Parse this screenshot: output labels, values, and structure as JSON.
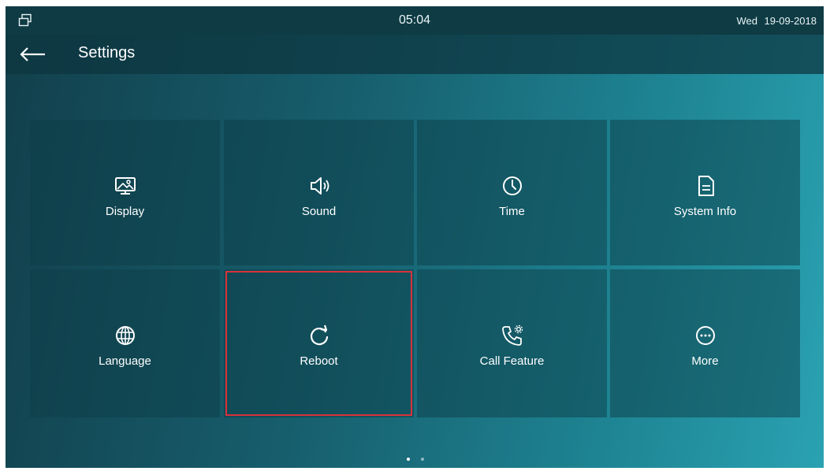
{
  "status_bar": {
    "time": "05:04",
    "day": "Wed",
    "date": "19-09-2018",
    "left_icon": "window-restore-icon"
  },
  "header": {
    "back_icon": "arrow-left-icon",
    "title": "Settings"
  },
  "tiles": [
    {
      "label": "Display",
      "icon": "display-icon"
    },
    {
      "label": "Sound",
      "icon": "speaker-icon"
    },
    {
      "label": "Time",
      "icon": "clock-icon"
    },
    {
      "label": "System Info",
      "icon": "document-icon"
    },
    {
      "label": "Language",
      "icon": "globe-icon"
    },
    {
      "label": "Reboot",
      "icon": "refresh-icon",
      "highlighted": true
    },
    {
      "label": "Call Feature",
      "icon": "phone-gear-icon"
    },
    {
      "label": "More",
      "icon": "more-dots-icon"
    }
  ],
  "pagination": {
    "pages": 2,
    "current": 1
  },
  "colors": {
    "highlight": "#d8323a",
    "status_bar": "#0f3b44",
    "background_start": "#123f4b",
    "background_end": "#2aa2b2"
  }
}
